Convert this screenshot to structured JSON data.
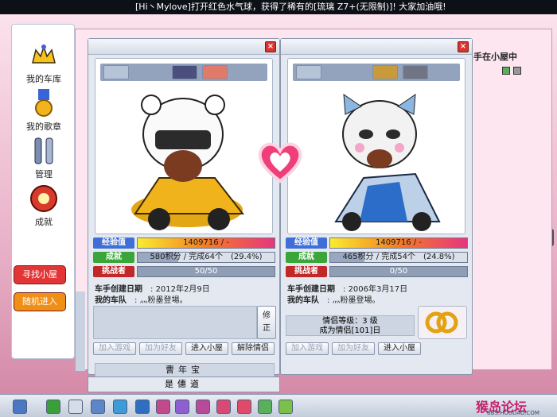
{
  "ticker": {
    "text": "[Hi丶Mylove]打开红色水气球，获得了稀有的[琉璃 Z7+(无限制)]! 大家加油哦!"
  },
  "sidebar": {
    "items": [
      {
        "label": "我的车库",
        "icon": "crown-icon"
      },
      {
        "label": "我的歌章",
        "icon": "medal-icon"
      },
      {
        "label": "管理",
        "icon": "tools-icon"
      },
      {
        "label": "成就",
        "icon": "achievement-icon"
      }
    ],
    "find_room_label": "寻找小屋",
    "random_enter_label": "随机进入"
  },
  "behind": {
    "room_status": "手在小屋中"
  },
  "left_card": {
    "exp_label": "经验值",
    "exp_value": "1409716 / -",
    "achievement_label": "成就",
    "achievement_value": "580积分 / 完成64个　(29.4%)",
    "achievement_pct": 29.4,
    "challenger_label": "挑战者",
    "challenger_value": "50/50",
    "created_label": "车手创建日期",
    "created_value": "2012年2月9日",
    "team_label": "我的车队",
    "team_value": "灬粉墨登場。",
    "edit_label": "修\n正",
    "buttons": [
      "加入游戏",
      "加为好友",
      "进入小屋",
      "解除情侣"
    ],
    "name": "曹年宝",
    "name2": "是僡道"
  },
  "right_card": {
    "exp_label": "经验值",
    "exp_value": "1409716 / -",
    "achievement_label": "成就",
    "achievement_value": "465积分 / 完成54个　(24.8%)",
    "achievement_pct": 24.8,
    "challenger_label": "挑战者",
    "challenger_value": "0/50",
    "created_label": "车手创建日期",
    "created_value": "2006年3月17日",
    "team_label": "我的车队",
    "team_value": "灬粉墨登場。",
    "couple_level": "情侣等级：3 级",
    "couple_days": "成为情侣[101]日",
    "buttons": [
      "加入游戏",
      "加为好友",
      "进入小屋"
    ]
  },
  "watermark": "猴岛论坛",
  "watermark_url": "BBS.HOUDAO.COM",
  "colors": {
    "exp_label": "#3f6fd6",
    "ach_label": "#3aa63a",
    "challenger_label": "#c0282a",
    "heart": "#ef3f7a"
  }
}
